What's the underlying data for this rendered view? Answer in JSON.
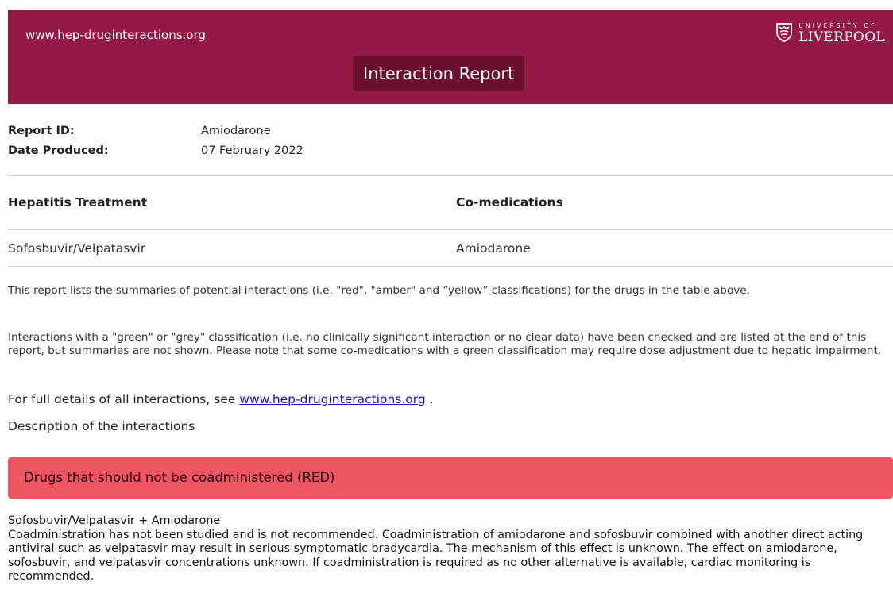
{
  "header": {
    "site_url": "www.hep-druginteractions.org",
    "title": "Interaction Report",
    "logo": {
      "top_line": "UNIVERSITY OF",
      "name": "LIVERPOOL",
      "icon": "crest-shield-icon"
    },
    "background_color": "#921a44",
    "title_background_color": "#6b0f2e"
  },
  "report_meta": {
    "report_id_label": "Report ID:",
    "report_id_value": "Amiodarone",
    "date_label": "Date Produced:",
    "date_value": "07 February 2022"
  },
  "drugs_table": {
    "headers": [
      "Hepatitis Treatment",
      "Co-medications"
    ],
    "rows": [
      [
        "Sofosbuvir/Velpatasvir",
        "Amiodarone"
      ]
    ]
  },
  "intro": {
    "paragraph1": "This report lists the summaries of potential interactions (i.e. \"red\", \"amber\" and “yellow” classifications) for the drugs in the table above.",
    "paragraph2": "Interactions with a \"green\" or \"grey\" classification (i.e. no clinically significant interaction or no clear data) have been checked and are listed at the end of this report, but summaries are not shown. Please note that some co-medications with a green classification may require dose adjustment due to hepatic impairment.",
    "full_details_prefix": "For full details of all interactions, see ",
    "full_details_link": "www.hep-druginteractions.org",
    "full_details_suffix": " .",
    "description_heading": "Description of the interactions"
  },
  "red_section": {
    "title": "Drugs that should not be coadministered (RED)",
    "color": "#ee5563",
    "interaction": {
      "title": "Sofosbuvir/Velpatasvir + Amiodarone",
      "text": "Coadministration has not been studied and is not recommended. Coadministration of amiodarone and sofosbuvir combined with another direct acting antiviral such as velpatasvir may result in serious symptomatic bradycardia. The mechanism of this effect is unknown. The effect on amiodarone, sofosbuvir, and velpatasvir concentrations unknown. If coadministration is required as no other alternative is available, cardiac monitoring is recommended."
    }
  }
}
